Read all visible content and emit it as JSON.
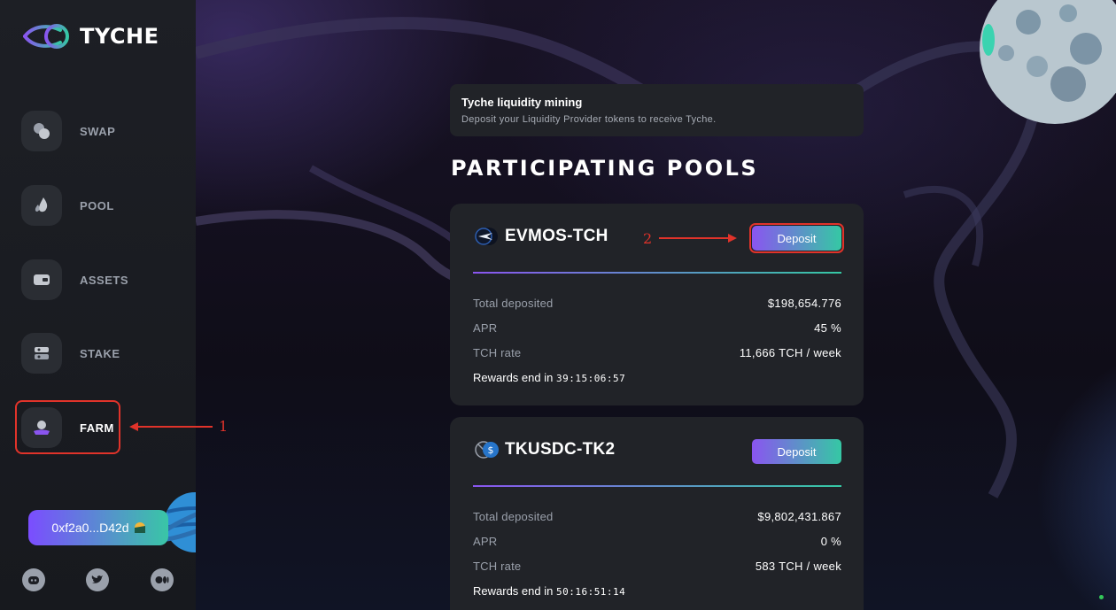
{
  "app": {
    "name": "TYCHE"
  },
  "sidebar": {
    "items": [
      {
        "label": "SWAP",
        "icon": "swap-icon"
      },
      {
        "label": "POOL",
        "icon": "pool-icon"
      },
      {
        "label": "ASSETS",
        "icon": "wallet-icon"
      },
      {
        "label": "STAKE",
        "icon": "stake-icon"
      },
      {
        "label": "FARM",
        "icon": "farm-icon",
        "active": true
      }
    ],
    "wallet_address": "0xf2a0...D42d",
    "socials": [
      "discord-icon",
      "twitter-icon",
      "medium-icon"
    ]
  },
  "annotations": {
    "one": "1",
    "two": "2"
  },
  "banner": {
    "title": "Tyche liquidity mining",
    "subtitle": "Deposit your Liquidity Provider tokens to receive Tyche."
  },
  "section_title": "PARTICIPATING POOLS",
  "pools": [
    {
      "name": "EVMOS-TCH",
      "deposit_label": "Deposit",
      "total_deposited_label": "Total deposited",
      "total_deposited": "$198,654.776",
      "apr_label": "APR",
      "apr": "45 %",
      "rate_label": "TCH rate",
      "rate": "11,666 TCH / week",
      "rewards_label": "Rewards end in",
      "rewards_end": "39:15:06:57"
    },
    {
      "name": "TKUSDC-TK2",
      "deposit_label": "Deposit",
      "total_deposited_label": "Total deposited",
      "total_deposited": "$9,802,431.867",
      "apr_label": "APR",
      "apr": "0 %",
      "rate_label": "TCH rate",
      "rate": "583 TCH / week",
      "rewards_label": "Rewards end in",
      "rewards_end": "50:16:51:14"
    }
  ],
  "colors": {
    "accent_start": "#8a55f0",
    "accent_end": "#35c8a4",
    "annotation": "#e0332a",
    "card": "#212328",
    "sidebar": "#1d1f25"
  }
}
